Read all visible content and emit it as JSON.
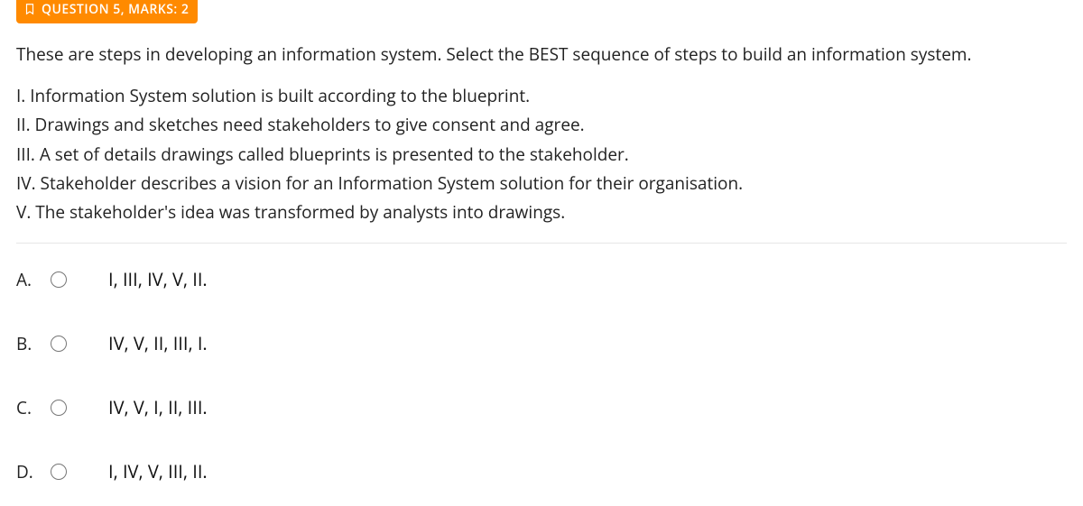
{
  "badge": {
    "label": "QUESTION 5, MARKS: 2"
  },
  "question": {
    "prompt": "These are steps in developing an information system. Select the BEST sequence of steps to build an information system.",
    "statements": [
      "I. Information System solution is built according to the blueprint.",
      "II. Drawings and sketches need stakeholders to give consent and agree.",
      "III. A set of details drawings called blueprints is presented to the stakeholder.",
      "IV. Stakeholder describes a vision for an Information System solution for their organisation.",
      "V. The stakeholder's idea was transformed by analysts into drawings."
    ]
  },
  "options": [
    {
      "letter": "A.",
      "text": "I, III, IV, V, II."
    },
    {
      "letter": "B.",
      "text": "IV, V, II, III, I."
    },
    {
      "letter": "C.",
      "text": "IV, V, I, II, III."
    },
    {
      "letter": "D.",
      "text": "I, IV, V, III, II."
    }
  ]
}
